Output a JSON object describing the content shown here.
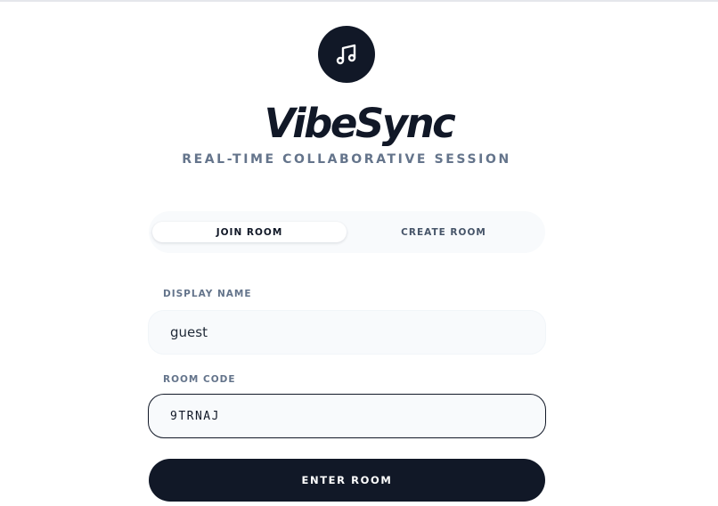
{
  "app": {
    "name": "VibeSync",
    "tagline": "REAL-TIME COLLABORATIVE SESSION",
    "logo_icon": "music-note-icon"
  },
  "tabs": [
    {
      "label": "JOIN ROOM",
      "active": true
    },
    {
      "label": "CREATE ROOM",
      "active": false
    }
  ],
  "form": {
    "display_name_label": "DISPLAY NAME",
    "display_name_value": "guest",
    "room_code_label": "ROOM CODE",
    "room_code_value": "9TRNAJ",
    "submit_label": "ENTER ROOM"
  },
  "colors": {
    "primary": "#111827",
    "muted": "#64748b",
    "input_bg": "#f8fafc"
  }
}
